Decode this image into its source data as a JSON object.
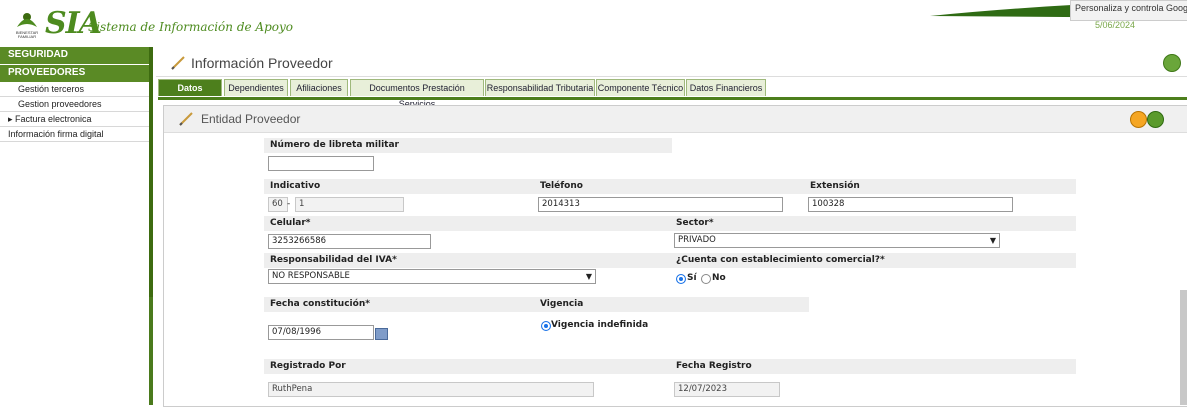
{
  "header": {
    "app_name": "SIA",
    "app_subtitle": "Sistema de Información de Apoyo",
    "logo_text": "BIENESTAR FAMILIAR",
    "chrome_tooltip": "Personaliza y controla Google Chrome",
    "date": "5/06/2024",
    "accent": "#4d8b1f"
  },
  "sidebar": {
    "sections": [
      "SEGURIDAD",
      "PROVEEDORES"
    ],
    "items": [
      {
        "label": "Gestión terceros"
      },
      {
        "label": "Gestion proveedores"
      },
      {
        "label": "▸ Factura electronica"
      },
      {
        "label": "Información firma digital"
      }
    ]
  },
  "main": {
    "title": "Información Proveedor",
    "tabs": [
      {
        "label": "Datos Básicos",
        "active": true
      },
      {
        "label": "Dependientes"
      },
      {
        "label": "Afiliaciones"
      },
      {
        "label": "Documentos Prestación Servicios"
      },
      {
        "label": "Responsabilidad Tributaria"
      },
      {
        "label": "Componente Técnico"
      },
      {
        "label": "Datos Financieros"
      }
    ],
    "section_title": "Entidad Proveedor"
  },
  "form": {
    "libreta_label": "Número de libreta militar",
    "libreta_value": "",
    "indicativo_label": "Indicativo",
    "indicativo_a": "60",
    "indicativo_sep": "-",
    "indicativo_b": "1",
    "telefono_label": "Teléfono",
    "telefono_value": "2014313",
    "extension_label": "Extensión",
    "extension_value": "100328",
    "celular_label": "Celular*",
    "celular_value": "3253266586",
    "sector_label": "Sector*",
    "sector_value": "PRIVADO",
    "iva_label": "Responsabilidad del IVA*",
    "iva_value": "NO RESPONSABLE",
    "establecimiento_label": "¿Cuenta con establecimiento comercial?*",
    "si_label": "Sí",
    "no_label": "No",
    "fecha_const_label": "Fecha constitución*",
    "fecha_const_value": "07/08/1996",
    "vigencia_label": "Vigencia",
    "vigencia_option": "Vigencia indefinida",
    "registrado_label": "Registrado Por",
    "registrado_value": "RuthPena",
    "fecha_reg_label": "Fecha Registro",
    "fecha_reg_value": "12/07/2023"
  }
}
